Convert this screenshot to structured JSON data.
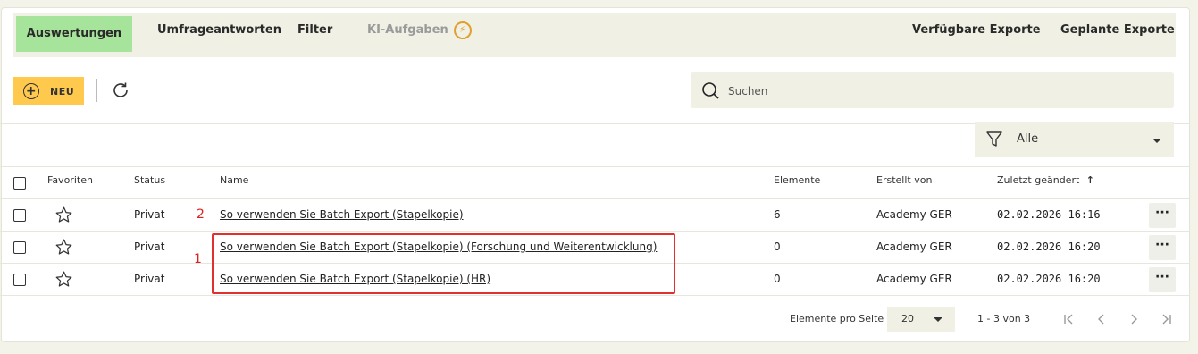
{
  "tabs": {
    "evaluations": "Auswertungen",
    "survey_answers": "Umfrageantworten",
    "filter": "Filter",
    "ai_tasks": "KI-Aufgaben",
    "available_exports": "Verfügbare Exporte",
    "scheduled_exports": "Geplante Exporte"
  },
  "toolbar": {
    "new_label": "NEU",
    "search_placeholder": "Suchen"
  },
  "filter": {
    "selected": "Alle"
  },
  "table": {
    "headers": {
      "favorites": "Favoriten",
      "status": "Status",
      "name": "Name",
      "elements": "Elemente",
      "created_by": "Erstellt von",
      "last_changed": "Zuletzt geändert",
      "sort_indicator": "↑"
    },
    "rows": [
      {
        "status": "Privat",
        "name": "So verwenden Sie Batch Export (Stapelkopie)",
        "elements": "6",
        "created_by": "Academy GER",
        "changed": "02.02.2026 16:16",
        "more": "···"
      },
      {
        "status": "Privat",
        "name": "So verwenden Sie Batch Export (Stapelkopie) (Forschung und Weiterentwicklung)",
        "elements": "0",
        "created_by": "Academy GER",
        "changed": "02.02.2026 16:20",
        "more": "···"
      },
      {
        "status": "Privat",
        "name": "So verwenden Sie Batch Export (Stapelkopie) (HR)",
        "elements": "0",
        "created_by": "Academy GER",
        "changed": "02.02.2026 16:20",
        "more": "···"
      }
    ]
  },
  "annotations": {
    "label_1": "1",
    "label_2": "2",
    "color": "#e03030"
  },
  "pagination": {
    "per_page_label": "Elemente pro Seite",
    "per_page_value": "20",
    "range": "1 - 3 von 3"
  },
  "colors": {
    "active_tab": "#a6e39b",
    "new_button": "#ffc94d",
    "ai_icon": "#e0a030",
    "panel": "#f0f0e4"
  },
  "icons": [
    "plus-circle-icon",
    "refresh-icon",
    "search-icon",
    "funnel-icon",
    "star-outline-icon",
    "more-icon",
    "first-page-icon",
    "prev-page-icon",
    "next-page-icon",
    "last-page-icon",
    "ai-lightning-icon"
  ]
}
